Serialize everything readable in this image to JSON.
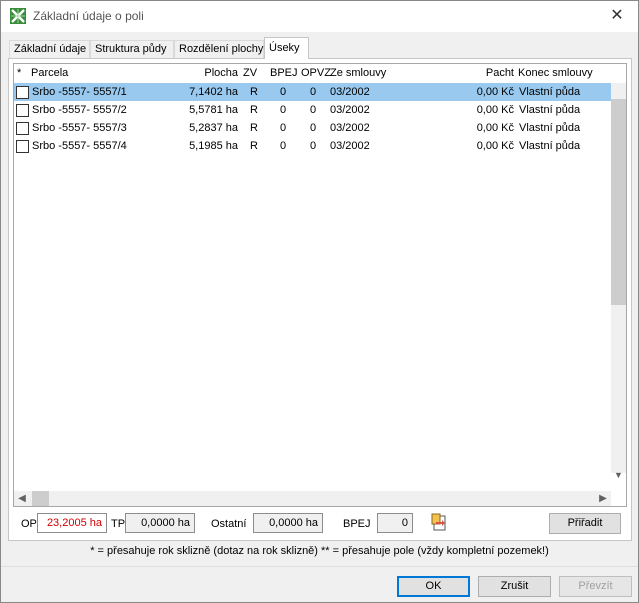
{
  "window": {
    "title": "Základní údaje o poli",
    "close_symbol": "✕",
    "icon": "excel-grid-icon"
  },
  "tabs": [
    {
      "label": "Základní údaje",
      "active": false
    },
    {
      "label": "Struktura půdy",
      "active": false
    },
    {
      "label": "Rozdělení plochy",
      "active": false
    },
    {
      "label": "Úseky",
      "active": true
    }
  ],
  "table": {
    "columns": {
      "star": "*",
      "parcela": "Parcela",
      "plocha": "Plocha",
      "zv": "ZV",
      "bpej": "BPEJ",
      "opvz": "OPVZ",
      "ze_smlouvy": "Ze smlouvy",
      "pacht": "Pacht",
      "konec": "Konec smlouvy"
    },
    "rows": [
      {
        "parcela": "Srbo -5557- 5557/1",
        "plocha": "7,1402 ha",
        "zv": "R",
        "bpej": "0",
        "opvz": "0",
        "ze_smlouvy": "03/2002",
        "pacht": "0,00 Kč",
        "konec": "Vlastní půda",
        "selected": true
      },
      {
        "parcela": "Srbo -5557- 5557/2",
        "plocha": "5,5781 ha",
        "zv": "R",
        "bpej": "0",
        "opvz": "0",
        "ze_smlouvy": "03/2002",
        "pacht": "0,00 Kč",
        "konec": "Vlastní půda",
        "selected": false
      },
      {
        "parcela": "Srbo -5557- 5557/3",
        "plocha": "5,2837 ha",
        "zv": "R",
        "bpej": "0",
        "opvz": "0",
        "ze_smlouvy": "03/2002",
        "pacht": "0,00 Kč",
        "konec": "Vlastní půda",
        "selected": false
      },
      {
        "parcela": "Srbo -5557- 5557/4",
        "plocha": "5,1985 ha",
        "zv": "R",
        "bpej": "0",
        "opvz": "0",
        "ze_smlouvy": "03/2002",
        "pacht": "0,00 Kč",
        "konec": "Vlastní půda",
        "selected": false
      }
    ]
  },
  "scroll": {
    "up": "▲",
    "down": "▼",
    "left": "◀",
    "right": "▶"
  },
  "summary": {
    "op_label": "OP",
    "op_value": "23,2005 ha",
    "tp_label": "TP",
    "tp_value": "0,0000 ha",
    "ostatni_label": "Ostatní",
    "ostatni_value": "0,0000 ha",
    "bpej_label": "BPEJ",
    "bpej_value": "0",
    "assign_label": "Přiřadit"
  },
  "footnote": "* = přesahuje rok sklizně (dotaz na rok sklizně)   ** = přesahuje pole (vždy kompletní pozemek!)",
  "buttons": {
    "ok": "OK",
    "cancel": "Zrušit",
    "transfer": "Převzít"
  },
  "colors": {
    "selection": "#99c9ef",
    "op_value": "#d00000",
    "default_button_border": "#0078d7"
  }
}
